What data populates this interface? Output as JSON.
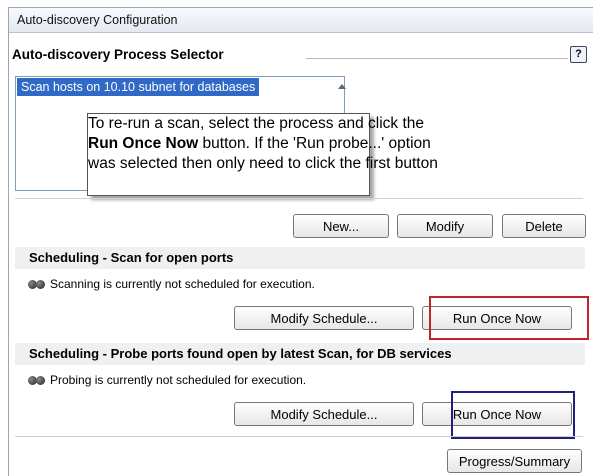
{
  "window": {
    "title": "Auto-discovery Configuration"
  },
  "selector": {
    "title": "Auto-discovery Process Selector",
    "help_label": "?",
    "items": [
      "Scan hosts on 10.10 subnet for databases"
    ]
  },
  "tooltip": {
    "line1": "To re-run a scan, select the process and click the",
    "line2_bold": "Run Once Now",
    "line2_rest": " button. If the 'Run probe...' option",
    "line3": "was selected then only need to click the first button"
  },
  "buttons": {
    "new": "New...",
    "modify": "Modify",
    "delete": "Delete"
  },
  "scan_section": {
    "title": "Scheduling - Scan for open ports",
    "status": "Scanning is currently not scheduled for execution.",
    "modify_schedule": "Modify Schedule...",
    "run_once": "Run Once Now"
  },
  "probe_section": {
    "title": "Scheduling - Probe ports found open by latest Scan, for DB services",
    "status": "Probing is currently not scheduled for execution.",
    "modify_schedule": "Modify Schedule...",
    "run_once": "Run Once Now"
  },
  "progress_button": "Progress/Summary",
  "colors": {
    "selection": "#3169c6",
    "highlight_red": "#c0272d",
    "highlight_blue": "#22207e"
  }
}
